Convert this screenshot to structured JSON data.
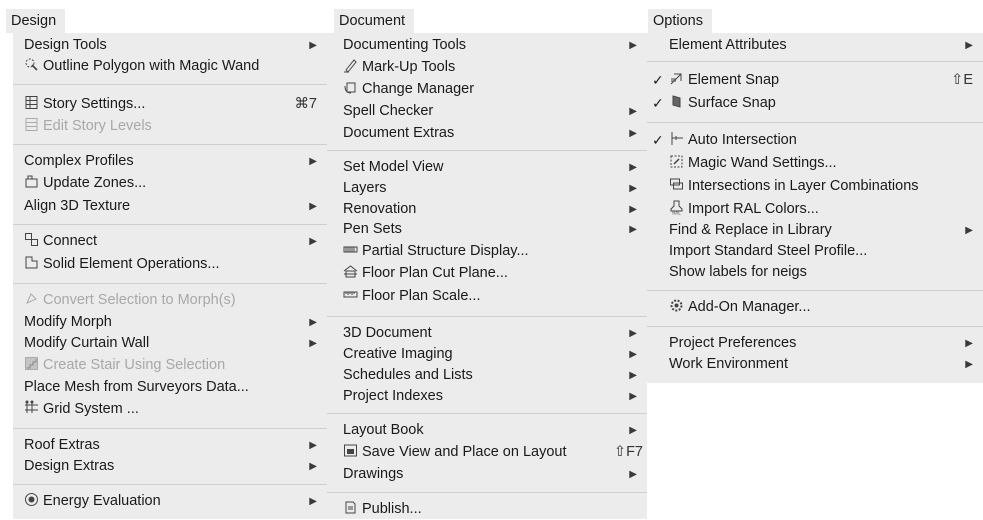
{
  "menus": {
    "design": {
      "title": "Design",
      "items": {
        "design_tools": "Design Tools",
        "outline_polygon": "Outline Polygon with Magic Wand",
        "story_settings": "Story Settings...",
        "story_settings_shortcut": "⌘7",
        "edit_story_levels": "Edit Story Levels",
        "complex_profiles": "Complex Profiles",
        "update_zones": "Update Zones...",
        "align_3d_texture": "Align 3D Texture",
        "connect": "Connect",
        "solid_element_ops": "Solid Element Operations...",
        "convert_to_morph": "Convert Selection to Morph(s)",
        "modify_morph": "Modify Morph",
        "modify_curtain_wall": "Modify Curtain Wall",
        "create_stair": "Create Stair Using Selection",
        "place_mesh": "Place Mesh from Surveyors Data...",
        "grid_system": "Grid System ...",
        "roof_extras": "Roof Extras",
        "design_extras": "Design Extras",
        "energy_evaluation": "Energy Evaluation"
      }
    },
    "document": {
      "title": "Document",
      "items": {
        "documenting_tools": "Documenting Tools",
        "markup_tools": "Mark-Up Tools",
        "change_manager": "Change Manager",
        "spell_checker": "Spell Checker",
        "document_extras": "Document Extras",
        "set_model_view": "Set Model View",
        "layers": "Layers",
        "renovation": "Renovation",
        "pen_sets": "Pen Sets",
        "partial_structure": "Partial Structure Display...",
        "floor_plan_cut": "Floor Plan Cut Plane...",
        "floor_plan_scale": "Floor Plan Scale...",
        "document_3d": "3D Document",
        "creative_imaging": "Creative Imaging",
        "schedules_lists": "Schedules and Lists",
        "project_indexes": "Project Indexes",
        "layout_book": "Layout Book",
        "save_view": "Save View and Place on Layout",
        "save_view_shortcut": "⇧F7",
        "drawings": "Drawings",
        "publish": "Publish..."
      }
    },
    "options": {
      "title": "Options",
      "items": {
        "element_attributes": "Element Attributes",
        "element_snap": "Element Snap",
        "element_snap_shortcut": "⇧E",
        "surface_snap": "Surface Snap",
        "auto_intersection": "Auto Intersection",
        "magic_wand_settings": "Magic Wand Settings...",
        "intersections_layer": "Intersections in Layer Combinations",
        "import_ral": "Import RAL Colors...",
        "find_replace": "Find & Replace in Library",
        "import_steel": "Import Standard Steel Profile...",
        "show_labels": "Show labels for neigs",
        "addon_manager": "Add-On Manager...",
        "project_preferences": "Project Preferences",
        "work_environment": "Work Environment"
      },
      "checkmark": "✓"
    }
  },
  "submenu_arrow": "▶",
  "colors": {
    "menu_bg": "#ececec",
    "disabled_text": "#a8a8a8",
    "separator": "#cfcfcf"
  }
}
